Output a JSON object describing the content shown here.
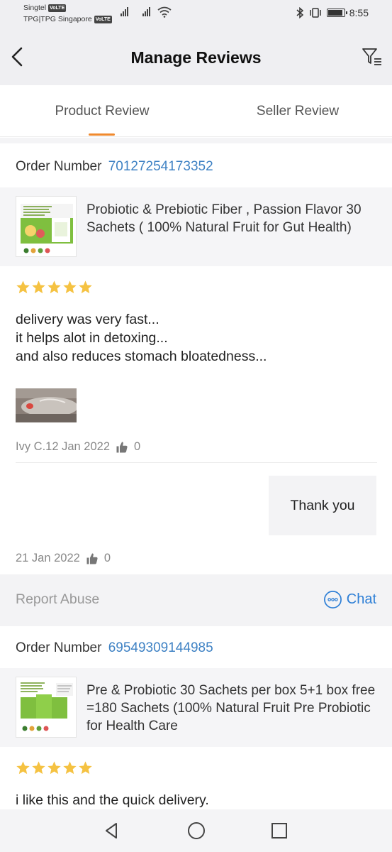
{
  "status_bar": {
    "carrier1": "Singtel",
    "carrier2": "TPG|TPG Singapore",
    "volte": "VoLTE",
    "time": "8:55",
    "battery_level": 0.9
  },
  "header": {
    "title": "Manage Reviews",
    "back_icon": "chevron-left-icon",
    "filter_icon": "filter-icon"
  },
  "tabs": [
    {
      "label": "Product Review",
      "active": true
    },
    {
      "label": "Seller Review",
      "active": false
    }
  ],
  "accent_color": "#f08a2e",
  "link_color": "#3f82c4",
  "star_color": "#f5c242",
  "reviews": [
    {
      "order_label": "Order Number",
      "order_number": "70127254173352",
      "product_name": "Probiotic & Prebiotic Fiber , Passion Flavor 30 Sachets ( 100% Natural Fruit for Gut Health)",
      "rating": 5,
      "text_lines": [
        "delivery was very fast...",
        "it helps alot in detoxing...",
        "and also reduces stomach bloatedness..."
      ],
      "reviewer_date": "Ivy C.12 Jan 2022",
      "likes": "0",
      "seller_reply": "Thank you",
      "reply_date": "21 Jan 2022",
      "reply_likes": "0",
      "report_label": "Report Abuse",
      "chat_label": "Chat"
    },
    {
      "order_label": "Order Number",
      "order_number": "69549309144985",
      "product_name": "Pre & Probiotic 30 Sachets per box  5+1 box free =180 Sachets (100% Natural Fruit Pre Probiotic for Health Care",
      "rating": 5,
      "text_lines": [
        "i like this and the quick delivery."
      ]
    }
  ]
}
